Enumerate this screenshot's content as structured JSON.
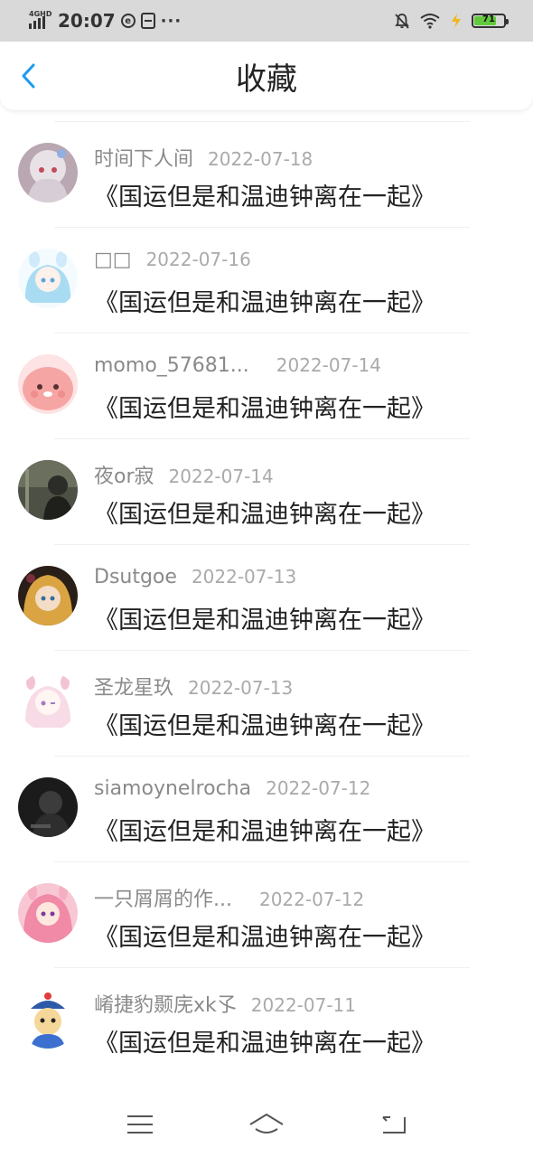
{
  "status_bar": {
    "network": "4GHD",
    "time": "20:07",
    "battery": "71",
    "icons": [
      "signal-icon",
      "data-saver-icon",
      "sim-card-icon",
      "more-dots-icon",
      "mute-bell-icon",
      "wifi-icon",
      "charging-icon",
      "battery-icon"
    ]
  },
  "header": {
    "title": "收藏",
    "back_icon": "chevron-left-icon"
  },
  "items": [
    {
      "username": "时间下人间",
      "date": "2022-07-18",
      "title": "《国运但是和温迪钟离在一起》"
    },
    {
      "username": "□□",
      "date": "2022-07-16",
      "title": "《国运但是和温迪钟离在一起》"
    },
    {
      "username": "momo_57681...",
      "date": "2022-07-14",
      "title": "《国运但是和温迪钟离在一起》"
    },
    {
      "username": "夜or寂",
      "date": "2022-07-14",
      "title": "《国运但是和温迪钟离在一起》"
    },
    {
      "username": "Dsutgoe",
      "date": "2022-07-13",
      "title": "《国运但是和温迪钟离在一起》"
    },
    {
      "username": "圣龙星玖",
      "date": "2022-07-13",
      "title": "《国运但是和温迪钟离在一起》"
    },
    {
      "username": "siamoynelrocha",
      "date": "2022-07-12",
      "title": "《国运但是和温迪钟离在一起》"
    },
    {
      "username": "一只屑屑的作...",
      "date": "2022-07-12",
      "title": "《国运但是和温迪钟离在一起》"
    },
    {
      "username": "崤捷豹颞庑xk孓",
      "date": "2022-07-11",
      "title": "《国运但是和温迪钟离在一起》"
    }
  ],
  "nav_bar": {
    "icons": [
      "menu-icon",
      "home-icon",
      "back-icon"
    ]
  },
  "colors": {
    "accent": "#1e9bf0",
    "status_bar_bg": "#d9d9d9",
    "username": "#8a8a8a",
    "date": "#aaaaaa",
    "title": "#222222"
  }
}
